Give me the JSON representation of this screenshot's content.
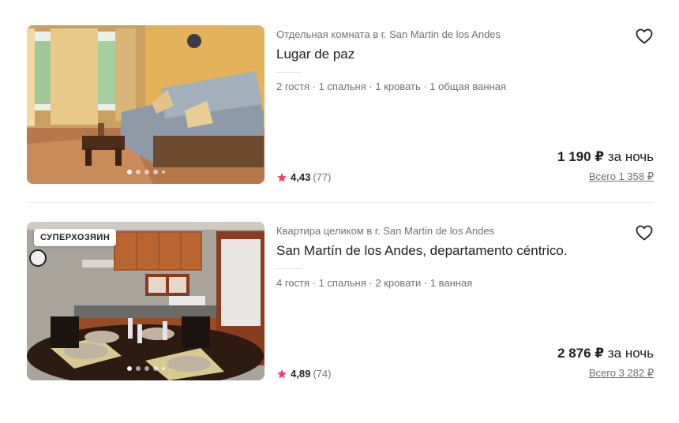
{
  "listings": [
    {
      "subtitle": "Отдельная комната в г. San Martin de los Andes",
      "title": "Lugar de paz",
      "details": "2 гостя · 1 спальня · 1 кровать · 1 общая ванная",
      "rating_score": "4,43",
      "rating_count": "(77)",
      "price_amount": "1 190 ₽",
      "price_unit": "за ночь",
      "total": "Всего 1 358 ₽",
      "photo_slides": 5,
      "photo_current_slide": 1
    },
    {
      "badge": "СУПЕРХОЗЯИН",
      "subtitle": "Квартира целиком в г. San Martin de los Andes",
      "title": "San Martín de los Andes, departamento céntrico.",
      "details": "4 гостя · 1 спальня · 2 кровати · 1 ванная",
      "rating_score": "4,89",
      "rating_count": "(74)",
      "price_amount": "2 876 ₽",
      "price_unit": "за ночь",
      "total": "Всего 3 282 ₽",
      "photo_slides": 5,
      "photo_current_slide": 1
    }
  ],
  "icons": {
    "favorite": "heart-outline-icon",
    "rating": "star-icon"
  },
  "colors": {
    "star": "#ff385c",
    "text_primary": "#222222",
    "text_secondary": "#717171"
  }
}
